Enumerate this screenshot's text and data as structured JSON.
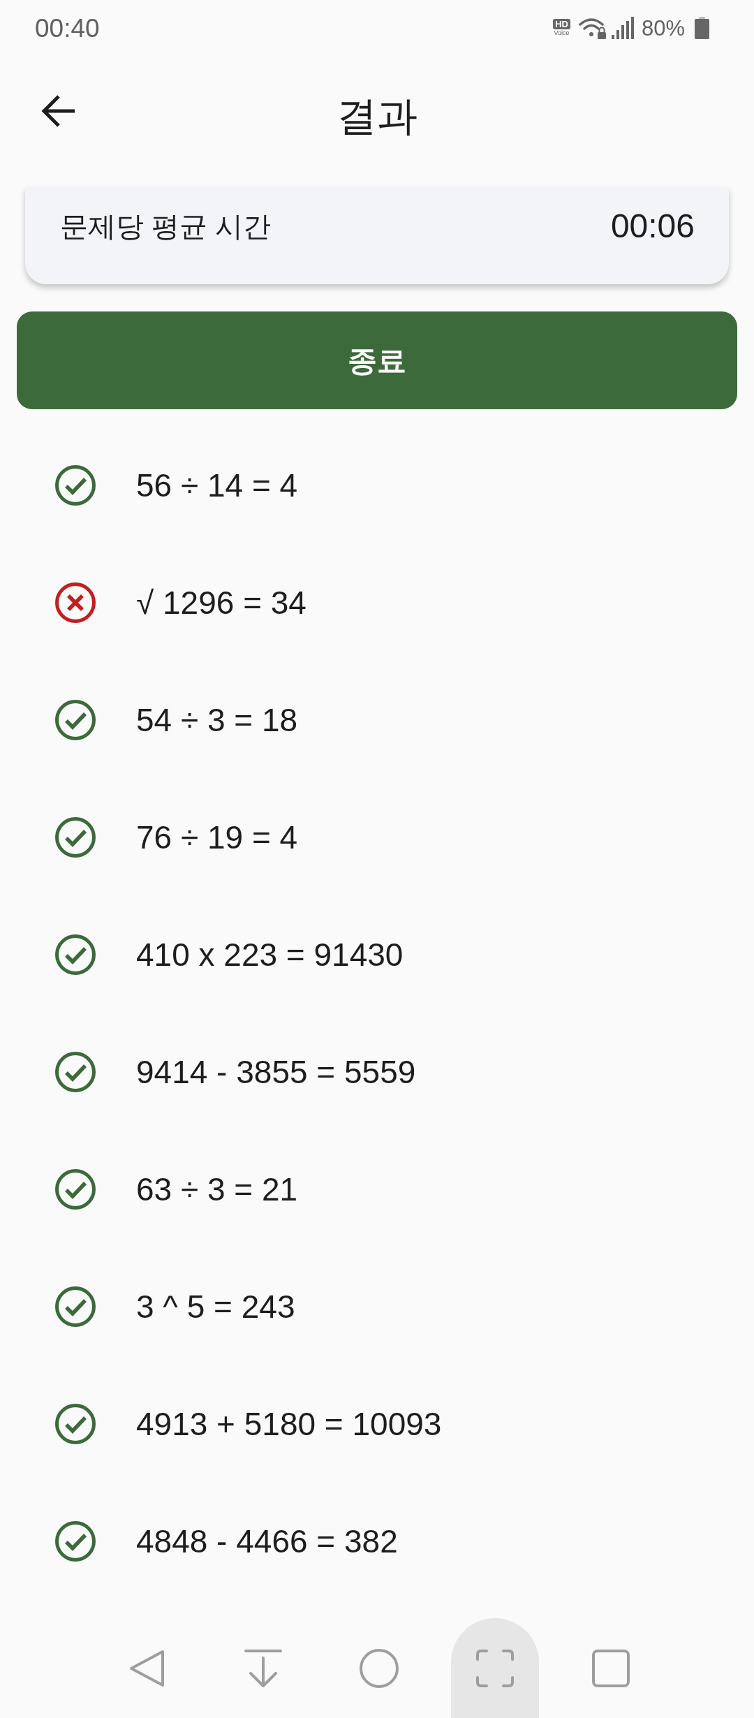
{
  "status_bar": {
    "time": "00:40",
    "hd_voice": {
      "top": "HD",
      "bottom": "Voice"
    },
    "battery": "80%"
  },
  "app_bar": {
    "title": "결과"
  },
  "summary_card": {
    "label": "문제당 평균 시간",
    "value": "00:06"
  },
  "finish_button": {
    "label": "종료"
  },
  "results": [
    {
      "expression": "56 ÷ 14 = 4",
      "correct": true
    },
    {
      "expression": "√ 1296 = 34",
      "correct": false
    },
    {
      "expression": "54 ÷ 3 = 18",
      "correct": true
    },
    {
      "expression": "76 ÷ 19 = 4",
      "correct": true
    },
    {
      "expression": "410 x 223 = 91430",
      "correct": true
    },
    {
      "expression": "9414 - 3855 = 5559",
      "correct": true
    },
    {
      "expression": "63 ÷ 3 = 21",
      "correct": true
    },
    {
      "expression": "3 ^ 5 = 243",
      "correct": true
    },
    {
      "expression": "4913 + 5180 = 10093",
      "correct": true
    },
    {
      "expression": "4848 - 4466 = 382",
      "correct": true
    }
  ],
  "nav_bar": [
    {
      "pressed": false
    },
    {
      "pressed": false
    },
    {
      "pressed": false
    },
    {
      "pressed": true
    },
    {
      "pressed": false
    }
  ]
}
